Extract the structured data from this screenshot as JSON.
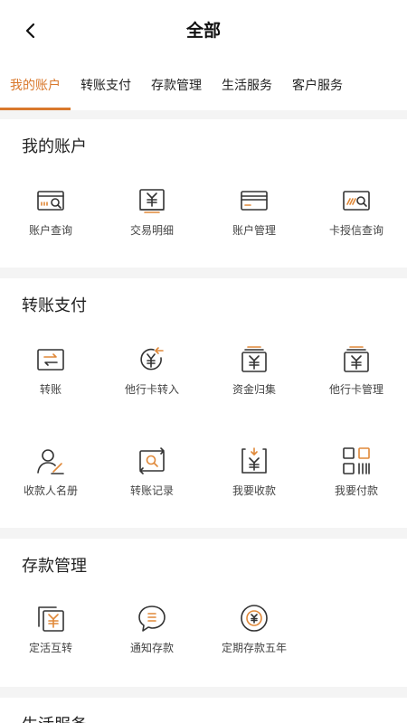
{
  "header": {
    "title": "全部"
  },
  "tabs": [
    {
      "label": "我的账户",
      "active": true
    },
    {
      "label": "转账支付",
      "active": false
    },
    {
      "label": "存款管理",
      "active": false
    },
    {
      "label": "生活服务",
      "active": false
    },
    {
      "label": "客户服务",
      "active": false
    }
  ],
  "sections": {
    "my_account": {
      "title": "我的账户",
      "items": [
        {
          "label": "账户查询",
          "icon": "account-query-icon"
        },
        {
          "label": "交易明细",
          "icon": "transaction-detail-icon"
        },
        {
          "label": "账户管理",
          "icon": "account-manage-icon"
        },
        {
          "label": "卡授信查询",
          "icon": "card-credit-query-icon"
        }
      ]
    },
    "transfer": {
      "title": "转账支付",
      "items": [
        {
          "label": "转账",
          "icon": "transfer-icon"
        },
        {
          "label": "他行卡转入",
          "icon": "other-bank-transfer-in-icon"
        },
        {
          "label": "资金归集",
          "icon": "fund-collection-icon"
        },
        {
          "label": "他行卡管理",
          "icon": "other-bank-card-manage-icon"
        },
        {
          "label": "收款人名册",
          "icon": "payee-list-icon"
        },
        {
          "label": "转账记录",
          "icon": "transfer-record-icon"
        },
        {
          "label": "我要收款",
          "icon": "receive-money-icon"
        },
        {
          "label": "我要付款",
          "icon": "pay-qr-icon"
        }
      ]
    },
    "deposit": {
      "title": "存款管理",
      "items": [
        {
          "label": "定活互转",
          "icon": "fixed-current-switch-icon"
        },
        {
          "label": "通知存款",
          "icon": "notice-deposit-icon"
        },
        {
          "label": "定期存款五年",
          "icon": "five-year-deposit-icon"
        }
      ]
    },
    "life": {
      "title": "生活服务"
    }
  },
  "colors": {
    "accent": "#d9782c",
    "background": "#f4f4f4"
  }
}
